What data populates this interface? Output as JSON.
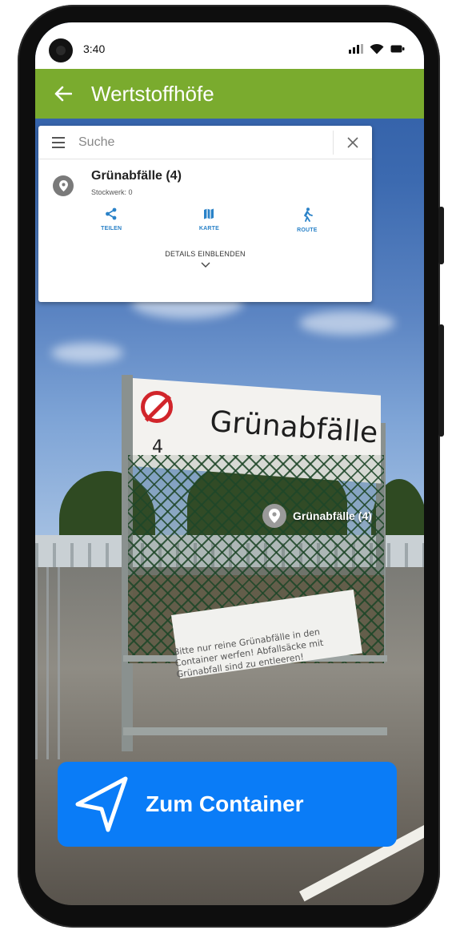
{
  "status_bar": {
    "time": "3:40"
  },
  "app_bar": {
    "title": "Wertstoffhöfe",
    "back_icon": "arrow-left-icon"
  },
  "search": {
    "placeholder": "Suche",
    "menu_icon": "hamburger-icon",
    "close_icon": "close-icon"
  },
  "place": {
    "title": "Grünabfälle (4)",
    "subtitle": "Stockwerk: 0",
    "icon": "map-pin-icon"
  },
  "actions": [
    {
      "label": "TEILEN",
      "icon": "share-icon"
    },
    {
      "label": "KARTE",
      "icon": "map-icon"
    },
    {
      "label": "ROUTE",
      "icon": "walking-icon"
    }
  ],
  "details": {
    "label": "DETAILS EINBLENDEN",
    "icon": "chevron-down-icon"
  },
  "scene": {
    "sign_text": "Grünabfälle",
    "sign_number": "4",
    "bottom_sign_text": "Bitte nur reine Grünabfälle in den Container werfen! Abfallsäcke mit Grünabfall sind zu entleeren!",
    "marker_label": "Grünabfälle (4)"
  },
  "navigate_button": {
    "label": "Zum Container",
    "icon": "navigation-arrow-icon"
  },
  "colors": {
    "app_bar": "#7aab2e",
    "action_blue": "#2a82c8",
    "nav_button": "#0a7cf7"
  }
}
